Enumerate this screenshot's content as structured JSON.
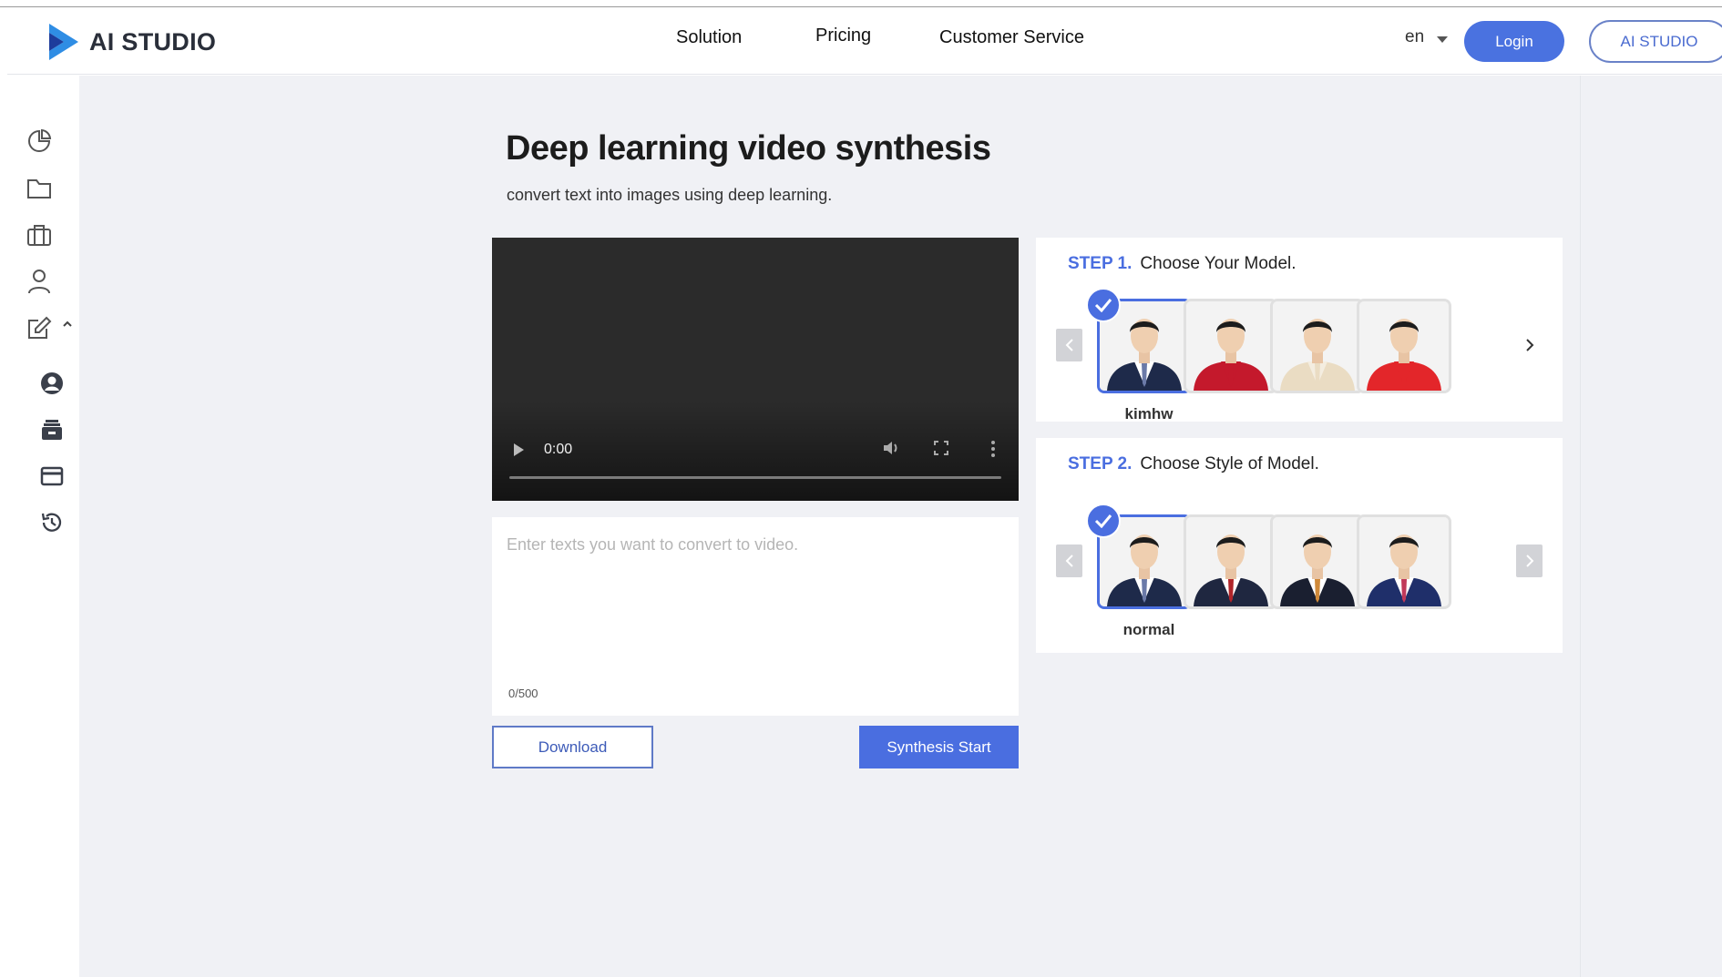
{
  "header": {
    "brand": "AI STUDIO",
    "nav": [
      "Solution",
      "Pricing",
      "Customer Service"
    ],
    "language": "en",
    "login_label": "Login",
    "studio_label": "AI STUDIO"
  },
  "sidebar": {
    "icons": [
      "dashboard-icon",
      "folder-icon",
      "briefcase-icon",
      "user-icon",
      "edit-icon",
      "account-circle-icon",
      "inbox-stack-icon",
      "credit-card-icon",
      "history-icon"
    ]
  },
  "main": {
    "title": "Deep learning video synthesis",
    "subtitle": "convert text into images using deep learning."
  },
  "video": {
    "time": "0:00"
  },
  "text_input": {
    "placeholder": "Enter texts you want to convert to video.",
    "value": "",
    "counter": "0/500"
  },
  "actions": {
    "download_label": "Download",
    "synthesis_label": "Synthesis Start"
  },
  "step1": {
    "step_label": "STEP 1.",
    "title": "Choose Your Model.",
    "selected_name": "kimhw",
    "models": [
      {
        "suit": "#1e2a4a",
        "shirt": "#ffffff",
        "tie": "#6b7aa8",
        "selected": true
      },
      {
        "suit": "#c4192c",
        "shirt": "#c4192c",
        "tie": "#c4192c",
        "selected": false
      },
      {
        "suit": "#eadcc3",
        "shirt": "#f4ede0",
        "tie": "#eadcc3",
        "selected": false
      },
      {
        "suit": "#e3262a",
        "shirt": "#e3262a",
        "tie": "#e3262a",
        "selected": false
      }
    ]
  },
  "step2": {
    "step_label": "STEP 2.",
    "title": "Choose Style of Model.",
    "selected_name": "normal",
    "styles": [
      {
        "suit": "#1e2a4a",
        "shirt": "#ffffff",
        "tie": "#6b7aa8",
        "selected": true
      },
      {
        "suit": "#1f2740",
        "shirt": "#ffffff",
        "tie": "#b0252a",
        "selected": false
      },
      {
        "suit": "#1a1f30",
        "shirt": "#ffffff",
        "tie": "#d08a3a",
        "selected": false
      },
      {
        "suit": "#1f2f6a",
        "shirt": "#ffffff",
        "tie": "#c03a5a",
        "selected": false
      }
    ]
  },
  "colors": {
    "accent": "#4a6ee0",
    "background": "#f0f1f5"
  }
}
